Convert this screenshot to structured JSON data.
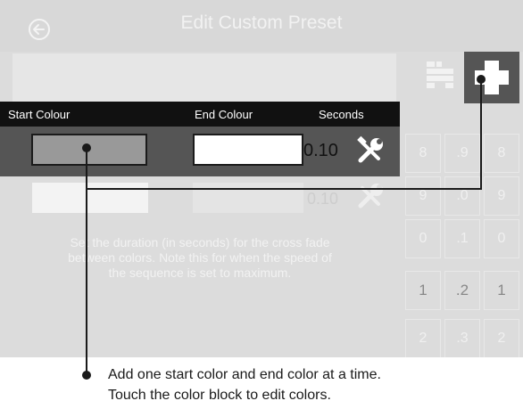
{
  "header": {
    "title": "Edit Custom Preset",
    "back_icon": "back-arrow-icon",
    "swap_icon": "swap-icon",
    "add_icon": "plus-icon"
  },
  "table": {
    "columns": [
      "Start Colour",
      "End Colour",
      "Seconds"
    ],
    "rows": [
      {
        "start_color": "#999999",
        "end_color": "#ffffff",
        "seconds": "0.10",
        "edit_icon": "tools-icon",
        "active": true
      },
      {
        "start_color": "#f3f3f3",
        "end_color": "#e4e4e4",
        "seconds": "0.10",
        "edit_icon": "tools-icon",
        "active": false
      }
    ]
  },
  "keypad": {
    "keys": [
      [
        "8",
        ".9",
        "8"
      ],
      [
        "9",
        ".0",
        "9"
      ],
      [
        "0",
        ".1",
        "0"
      ],
      [
        "1",
        ".2",
        "1"
      ],
      [
        "2",
        ".3",
        "2"
      ]
    ]
  },
  "hint": {
    "lines": [
      "Set the duration (in seconds) for the cross fade",
      "between colors. Note this for when the speed of",
      "the sequence is set to maximum."
    ]
  },
  "callout": {
    "lines": [
      "Add one start color and end color at a time.",
      "Touch the color block to edit colors."
    ]
  },
  "colors": {
    "screen_bg": "#dcdcdc",
    "header_bar": "#111111",
    "active_row": "#555555",
    "callout_line": "#1a1a1a"
  }
}
